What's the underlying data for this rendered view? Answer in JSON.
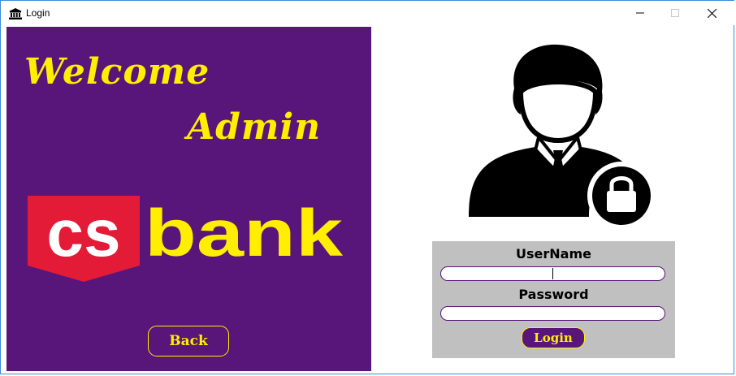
{
  "window": {
    "title": "Login",
    "icon": "bank-icon"
  },
  "left_panel": {
    "welcome": "Welcome",
    "admin": "Admin",
    "logo_text_cs": "cs",
    "logo_text_bank": "bank",
    "back_label": "Back",
    "background_color": "#58157a",
    "accent_color": "#ffee00"
  },
  "login_form": {
    "username_label": "UserName",
    "username_value": "",
    "password_label": "Password",
    "password_value": "",
    "login_label": "Login",
    "avatar_icon": "user-lock-icon"
  }
}
